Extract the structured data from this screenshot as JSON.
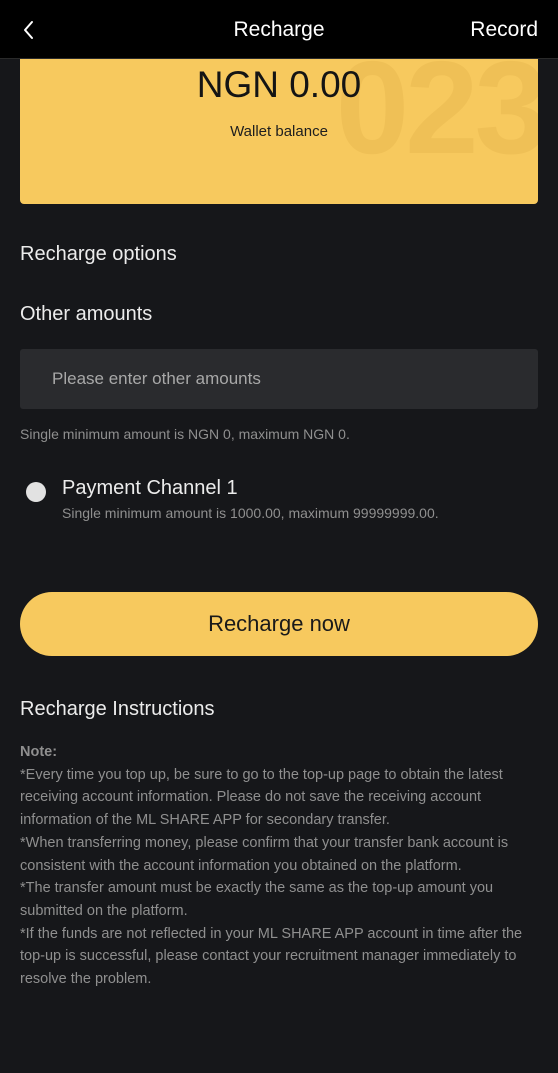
{
  "header": {
    "back_icon": "chevron-left-icon",
    "title": "Recharge",
    "record_label": "Record"
  },
  "balance_card": {
    "amount": "NGN 0.00",
    "label": "Wallet balance",
    "watermark": "023",
    "background_color": "#f7c95e"
  },
  "recharge_options": {
    "heading": "Recharge options"
  },
  "other_amounts": {
    "heading": "Other amounts",
    "input_placeholder": "Please enter other amounts",
    "input_value": "",
    "hint": "Single minimum amount is NGN 0, maximum NGN 0."
  },
  "payment_channels": [
    {
      "name": "Payment Channel 1",
      "limit": "Single minimum amount is 1000.00, maximum 99999999.00.",
      "selected": false
    }
  ],
  "recharge_button": {
    "label": "Recharge now",
    "color": "#f7c95e"
  },
  "instructions": {
    "title": "Recharge Instructions",
    "note_label": "Note:",
    "lines": [
      "*Every time you top up, be sure to go to the top-up page to obtain the latest receiving account information. Please do not save the receiving account information of the ML SHARE APP for secondary transfer.",
      "*When transferring money, please confirm that your transfer bank account is consistent with the account information you obtained on the platform.",
      "*The transfer amount must be exactly the same as the top-up amount you submitted on the platform.",
      "*If the funds are not reflected in your ML SHARE APP account in time after the top-up is successful, please contact your recruitment manager immediately to resolve the problem."
    ]
  }
}
